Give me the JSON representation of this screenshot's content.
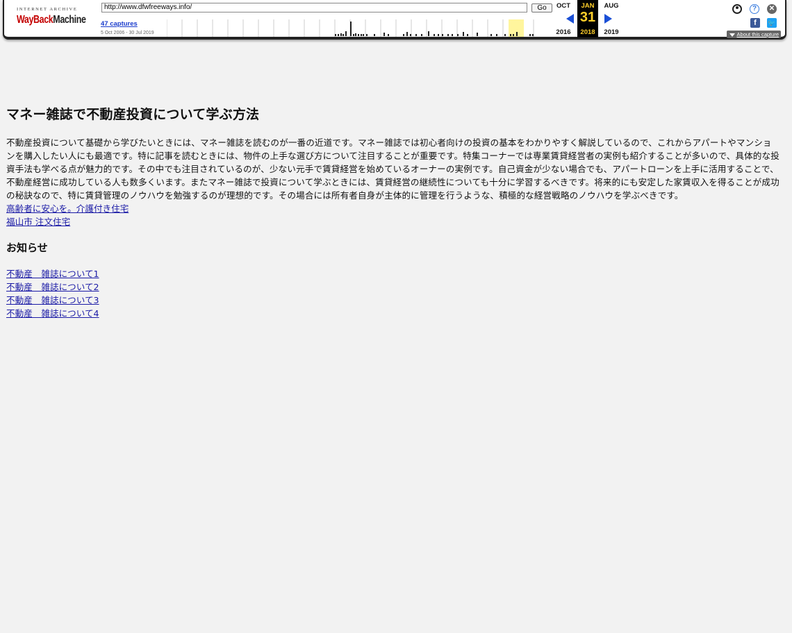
{
  "toolbar": {
    "logo_top": "INTERNET ARCHIVE",
    "logo_word1": "WayBack",
    "logo_word2": "Machine",
    "url_value": "http://www.dfwfreeways.info/",
    "go_label": "Go",
    "captures_label": "47 captures",
    "date_range": "5 Oct 2006 - 30 Jul 2019",
    "prev": {
      "month": "OCT",
      "year": "2016"
    },
    "current": {
      "month": "JAN",
      "day": "31",
      "year": "2018"
    },
    "next": {
      "month": "AUG",
      "year": "2019"
    },
    "about_label": "About this capture",
    "colors": {
      "current_bg": "#000000",
      "current_fg": "#ffcf2a",
      "arrow": "#1a4fd6",
      "captures_link": "#1a3ccc"
    }
  },
  "page": {
    "title": "マネー雑誌で不動産投資について学ぶ方法",
    "intro": "不動産投資について基礎から学びたいときには、マネー雑誌を読むのが一番の近道です。マネー雑誌では初心者向けの投資の基本をわかりやすく解説しているので、これからアパートやマンションを購入したい人にも最適です。特に記事を読むときには、物件の上手な選び方について注目することが重要です。特集コーナーでは専業賃貸経営者の実例も紹介することが多いので、具体的な投資手法も学べる点が魅力的です。その中でも注目されているのが、少ない元手で賃貸経営を始めているオーナーの実例です。自己資金が少ない場合でも、アパートローンを上手に活用することで、不動産経営に成功している人も数多くいます。またマネー雑誌で投資について学ぶときには、賃貸経営の継続性についても十分に学習するべきです。将来的にも安定した家賃収入を得ることが成功の秘訣なので、特に賃貸管理のノウハウを勉強するのが理想的です。その場合には所有者自身が主体的に管理を行うような、積極的な経営戦略のノウハウを学ぶべきです。",
    "links": [
      "高齢者に安心を。介護付き住宅",
      "福山市 注文住宅"
    ],
    "news_heading": "お知らせ",
    "news_links": [
      "不動産　雑誌について1",
      "不動産　雑誌について2",
      "不動産　雑誌について3",
      "不動産　雑誌について4"
    ],
    "link_color": "#1a1aa6"
  }
}
